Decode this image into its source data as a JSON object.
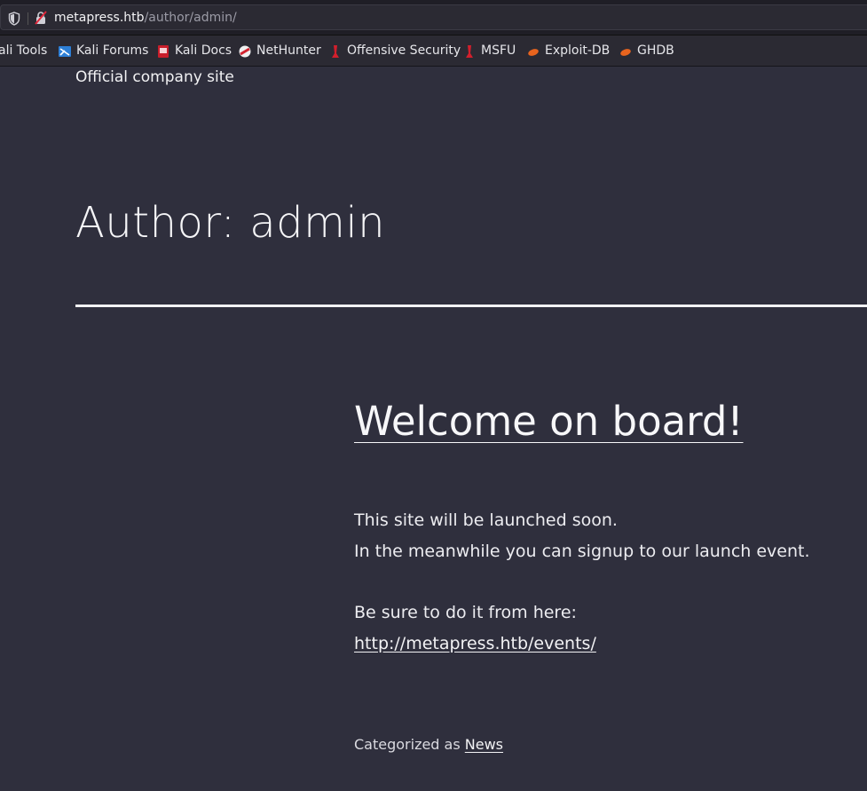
{
  "browser": {
    "url_host": "metapress.htb",
    "url_path": "/author/admin/"
  },
  "bookmarks": [
    {
      "label": "ali Tools",
      "icon": "kali-tools-icon"
    },
    {
      "label": "Kali Forums",
      "icon": "kali-forums-icon"
    },
    {
      "label": "Kali Docs",
      "icon": "kali-docs-icon"
    },
    {
      "label": "NetHunter",
      "icon": "nethunter-icon"
    },
    {
      "label": "Offensive Security",
      "icon": "offensive-security-icon"
    },
    {
      "label": "MSFU",
      "icon": "msfu-icon"
    },
    {
      "label": "Exploit-DB",
      "icon": "exploit-db-icon"
    },
    {
      "label": "GHDB",
      "icon": "ghdb-icon"
    }
  ],
  "site": {
    "description": "Official company site"
  },
  "archive": {
    "title": "Author: admin"
  },
  "post": {
    "title": "Welcome on board!",
    "line1": "This site will be launched soon.",
    "line2": "In the meanwhile you can signup to our launch event.",
    "line3": "Be sure to do it from here:",
    "link": "http://metapress.htb/events/",
    "categorized_prefix": "Categorized as",
    "category": "News"
  },
  "colors": {
    "page_bg": "#2f2f3d",
    "text": "#f2f2f4"
  }
}
